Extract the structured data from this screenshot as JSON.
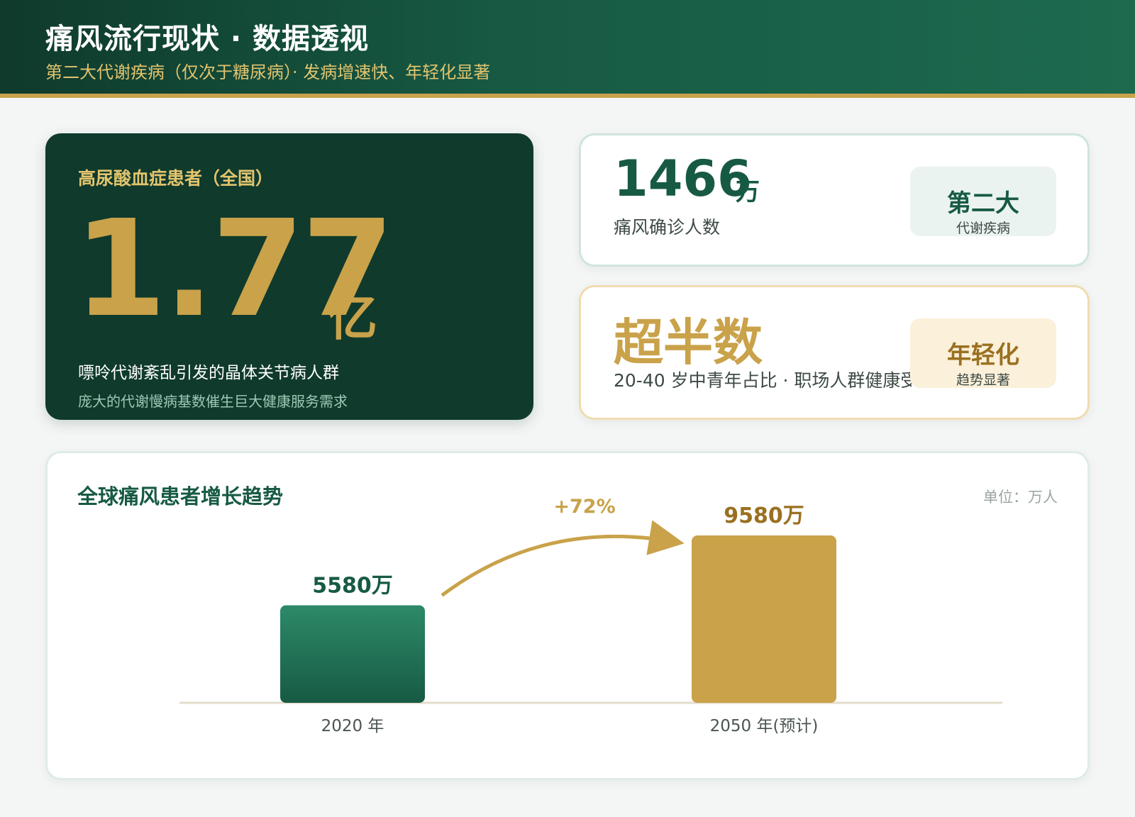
{
  "header": {
    "title": "痛风流行现状 · 数据透视",
    "subtitle": "第二大代谢疾病（仅次于糖尿病）· 发病增速快、年轻化显著"
  },
  "hero": {
    "label": "高尿酸血症患者（全国）",
    "value": "1.77",
    "unit": "亿",
    "desc": "嘌呤代谢紊乱引发的晶体关节病人群",
    "note": "庞大的代谢慢病基数催生巨大健康服务需求"
  },
  "card_gout": {
    "value": "1466",
    "unit": "万",
    "label": "痛风确诊人数",
    "badge_main": "第二大",
    "badge_sub": "代谢疾病"
  },
  "card_young": {
    "value": "超半数",
    "label": "20-40 岁中青年占比 · 职场人群健康受",
    "badge_main": "年轻化",
    "badge_sub": "趋势显著"
  },
  "colors": {
    "green_dark": "#0f3a2c",
    "green": "#175a44",
    "gold": "#c9a24a",
    "gold_dark": "#9a7020"
  },
  "chart_data": {
    "type": "bar",
    "title": "全球痛风患者增长趋势",
    "unit_label": "单位：万人",
    "categories": [
      "2020 年",
      "2050 年(预计)"
    ],
    "values": [
      5580,
      9580
    ],
    "value_labels": [
      "5580万",
      "9580万"
    ],
    "growth_label": "+72%",
    "bar_colors": [
      "#175a44",
      "#c9a24a"
    ]
  }
}
